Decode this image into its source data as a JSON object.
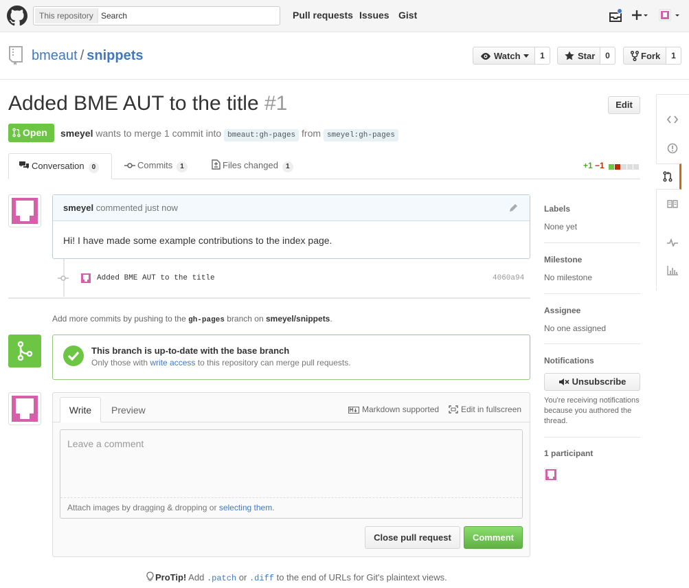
{
  "header": {
    "search_scope": "This repository",
    "search_placeholder": "Search",
    "nav": [
      "Pull requests",
      "Issues",
      "Gist"
    ]
  },
  "repo": {
    "owner": "bmeaut",
    "sep": "/",
    "name": "snippets",
    "watch_label": "Watch",
    "watch_count": "1",
    "star_label": "Star",
    "star_count": "0",
    "fork_label": "Fork",
    "fork_count": "1"
  },
  "pr": {
    "title": "Added BME AUT to the title",
    "number": "#1",
    "edit_label": "Edit",
    "state": "Open",
    "author": "smeyel",
    "merge_text": "wants to merge 1 commit into",
    "base_branch": "bmeaut:gh-pages",
    "from_text": "from",
    "head_branch": "smeyel:gh-pages"
  },
  "tabs": [
    {
      "label": "Conversation",
      "count": "0"
    },
    {
      "label": "Commits",
      "count": "1"
    },
    {
      "label": "Files changed",
      "count": "1"
    }
  ],
  "diffstat": {
    "added": "+1",
    "removed": "−1"
  },
  "comment": {
    "author": "smeyel",
    "meta": "commented just now",
    "body": "Hi! I have made some example contributions to the index page."
  },
  "commit": {
    "message": "Added BME AUT to the title",
    "sha": "4060a94"
  },
  "push_hint": {
    "pre": "Add more commits by pushing to the",
    "branch": "gh-pages",
    "mid": "branch on",
    "repo": "smeyel/snippets",
    "end": "."
  },
  "merge": {
    "title": "This branch is up-to-date with the base branch",
    "desc_pre": "Only those with",
    "desc_link": "write access",
    "desc_post": "to this repository can merge pull requests."
  },
  "new_comment": {
    "write_tab": "Write",
    "preview_tab": "Preview",
    "markdown": "Markdown supported",
    "fullscreen": "Edit in fullscreen",
    "placeholder": "Leave a comment",
    "attach_pre": "Attach images by dragging & dropping or",
    "attach_link": "selecting them",
    "attach_post": ".",
    "close_label": "Close pull request",
    "comment_label": "Comment"
  },
  "sidebar": {
    "labels_h": "Labels",
    "labels_v": "None yet",
    "milestone_h": "Milestone",
    "milestone_v": "No milestone",
    "assignee_h": "Assignee",
    "assignee_v": "No one assigned",
    "notifications_h": "Notifications",
    "unsubscribe": "Unsubscribe",
    "notif_desc": "You're receiving notifications because you authored the thread.",
    "participants": "1 participant"
  },
  "protip": {
    "bold": "ProTip!",
    "pre": "Add",
    "patch": ".patch",
    "or": "or",
    "diff": ".diff",
    "post": "to the end of URLs for Git's plaintext views."
  },
  "colors": {
    "accent": "#4078c0",
    "open": "#6cc644",
    "avatar": "#d55fa8",
    "removed": "#bd2c00"
  },
  "icons": [
    "github-logo-icon",
    "inbox-icon",
    "plus-icon",
    "repo-icon",
    "eye-icon",
    "star-icon",
    "fork-icon",
    "pull-request-icon",
    "commit-icon",
    "file-diff-icon",
    "pencil-icon",
    "check-icon",
    "markdown-icon",
    "fullscreen-icon",
    "mute-icon",
    "lightbulb-icon",
    "code-icon",
    "issue-icon",
    "wiki-icon",
    "pulse-icon",
    "graph-icon"
  ]
}
